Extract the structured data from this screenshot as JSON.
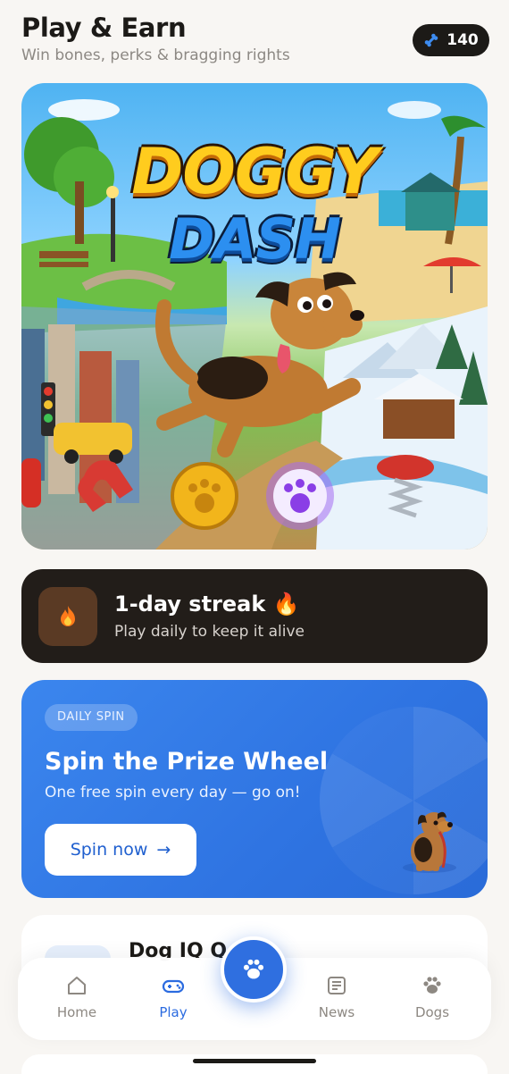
{
  "header": {
    "title": "Play & Earn",
    "subtitle": "Win bones, perks & bragging rights",
    "bones_count": "140"
  },
  "hero": {
    "title_line1": "DOGGY",
    "title_line2": "DASH"
  },
  "streak": {
    "title": "1-day streak 🔥",
    "subtitle": "Play daily to keep it alive"
  },
  "spin": {
    "tag": "DAILY SPIN",
    "title": "Spin the Prize Wheel",
    "subtitle": "One free spin every day — go on!",
    "button_label": "Spin now",
    "button_arrow": "→"
  },
  "quiz": {
    "title": "Dog IQ Q"
  },
  "nav": {
    "items": [
      {
        "label": "Home",
        "icon": "home-icon"
      },
      {
        "label": "Play",
        "icon": "gamepad-icon"
      },
      {
        "label": "News",
        "icon": "newspaper-icon"
      },
      {
        "label": "Dogs",
        "icon": "paw-icon"
      }
    ],
    "active": "Play"
  },
  "colors": {
    "accent": "#2f6fe0",
    "streak_bg": "#221d19",
    "page_bg": "#f8f6f3"
  }
}
